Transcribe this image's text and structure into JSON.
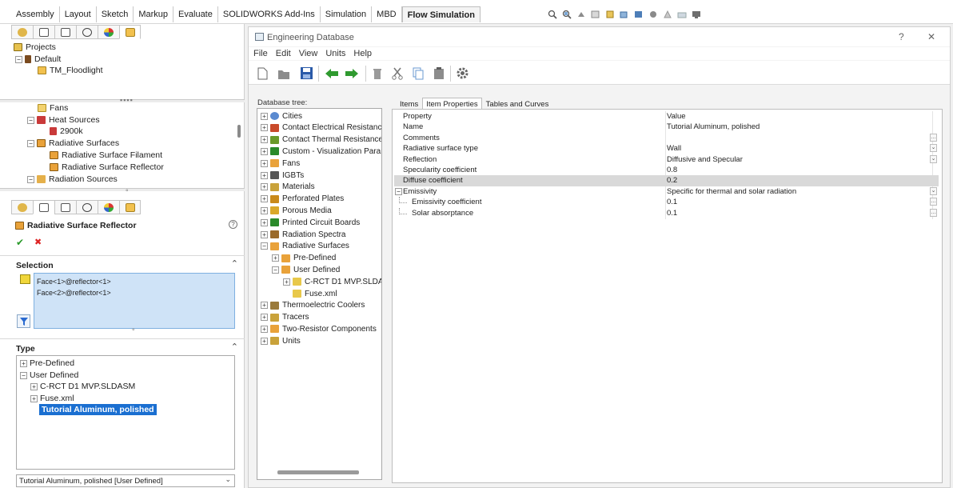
{
  "ribbon": {
    "tabs": [
      "Assembly",
      "Layout",
      "Sketch",
      "Markup",
      "Evaluate",
      "SOLIDWORKS Add-Ins",
      "Simulation",
      "MBD",
      "Flow Simulation"
    ],
    "active_tab": "Flow Simulation",
    "tool_icons": [
      "zoom-fit-icon",
      "zoom-area-icon",
      "previous-view-icon",
      "section-view-icon",
      "dynamic-annotation-icon",
      "view-orientation-icon",
      "display-style-icon",
      "hide-show-icon",
      "edit-appearance-icon",
      "apply-scene-icon",
      "view-settings-icon"
    ]
  },
  "project_tree": {
    "items": [
      {
        "label": "Projects",
        "icon": "projects-icon"
      },
      {
        "label": "Default",
        "icon": "config-icon"
      },
      {
        "label": "TM_Floodlight",
        "icon": "project-icon"
      }
    ]
  },
  "feature_tree": {
    "items": [
      {
        "label": "Fans",
        "icon": "fans-folder-icon"
      },
      {
        "label": "Heat Sources",
        "icon": "heat-sources-icon"
      },
      {
        "label": "2900k",
        "icon": "heat-source-icon"
      },
      {
        "label": "Radiative Surfaces",
        "icon": "radiative-surfaces-icon"
      },
      {
        "label": "Radiative Surface Filament",
        "icon": "radiative-surface-icon"
      },
      {
        "label": "Radiative Surface Reflector",
        "icon": "radiative-surface-icon"
      },
      {
        "label": "Radiation Sources",
        "icon": "radiation-sources-icon"
      }
    ]
  },
  "property_manager": {
    "title": "Radiative Surface Reflector",
    "help_glyph": "?",
    "ok_glyph": "✔",
    "cancel_glyph": "✖",
    "selection_header": "Selection",
    "selection_items": [
      "Face<1>@reflector<1>",
      "Face<2>@reflector<1>"
    ],
    "type_header": "Type",
    "type_tree": [
      {
        "label": "Pre-Defined",
        "level": 0,
        "toggle": "+"
      },
      {
        "label": "User Defined",
        "level": 0,
        "toggle": "−"
      },
      {
        "label": "C-RCT D1 MVP.SLDASM",
        "level": 1,
        "toggle": "+"
      },
      {
        "label": "Fuse.xml",
        "level": 1,
        "toggle": "+"
      },
      {
        "label": "Tutorial Aluminum, polished",
        "level": 2,
        "selected": true
      }
    ],
    "type_combo_value": "Tutorial Aluminum, polished [User Defined]"
  },
  "engineering_db": {
    "title": "Engineering Database",
    "help_glyph": "?",
    "close_glyph": "✕",
    "menu": [
      "File",
      "Edit",
      "View",
      "Units",
      "Help"
    ],
    "toolbar_icons": [
      "new-icon",
      "open-icon",
      "save-icon",
      "back-icon",
      "forward-icon",
      "delete-icon",
      "cut-icon",
      "copy-icon",
      "paste-icon",
      "settings-icon"
    ],
    "tree_label": "Database tree:",
    "tree": [
      {
        "label": "Cities",
        "level": 0,
        "toggle": "+"
      },
      {
        "label": "Contact Electrical Resistance",
        "level": 0,
        "toggle": "+"
      },
      {
        "label": "Contact Thermal Resistance",
        "level": 0,
        "toggle": "+"
      },
      {
        "label": "Custom - Visualization Parameters",
        "level": 0,
        "toggle": "+"
      },
      {
        "label": "Fans",
        "level": 0,
        "toggle": "+"
      },
      {
        "label": "IGBTs",
        "level": 0,
        "toggle": "+"
      },
      {
        "label": "Materials",
        "level": 0,
        "toggle": "+"
      },
      {
        "label": "Perforated Plates",
        "level": 0,
        "toggle": "+"
      },
      {
        "label": "Porous Media",
        "level": 0,
        "toggle": "+"
      },
      {
        "label": "Printed Circuit Boards",
        "level": 0,
        "toggle": "+"
      },
      {
        "label": "Radiation Spectra",
        "level": 0,
        "toggle": "+"
      },
      {
        "label": "Radiative Surfaces",
        "level": 0,
        "toggle": "−"
      },
      {
        "label": "Pre-Defined",
        "level": 1,
        "toggle": "+"
      },
      {
        "label": "User Defined",
        "level": 1,
        "toggle": "−"
      },
      {
        "label": "C-RCT D1 MVP.SLDASM",
        "level": 2,
        "toggle": "+"
      },
      {
        "label": "Fuse.xml",
        "level": 2,
        "toggle": ""
      },
      {
        "label": "Thermoelectric Coolers",
        "level": 0,
        "toggle": "+"
      },
      {
        "label": "Tracers",
        "level": 0,
        "toggle": "+"
      },
      {
        "label": "Two-Resistor Components",
        "level": 0,
        "toggle": "+"
      },
      {
        "label": "Units",
        "level": 0,
        "toggle": "+"
      }
    ],
    "item_tabs": [
      "Items",
      "Item Properties",
      "Tables and Curves"
    ],
    "active_item_tab": "Item Properties",
    "properties": [
      {
        "name": "Property",
        "value": "Value",
        "indent": 0
      },
      {
        "name": "Name",
        "value": "Tutorial Aluminum, polished",
        "indent": 0
      },
      {
        "name": "Comments",
        "value": "",
        "indent": 0,
        "button": "…"
      },
      {
        "name": "Radiative surface type",
        "value": "Wall",
        "indent": 0,
        "button": "⌄"
      },
      {
        "name": "Reflection",
        "value": "Diffusive and Specular",
        "indent": 0,
        "button": "⌄"
      },
      {
        "name": "Specularity coefficient",
        "value": "0.8",
        "indent": 0
      },
      {
        "name": "Diffuse coefficient",
        "value": "0.2",
        "indent": 0,
        "highlight": true
      },
      {
        "name": "Emissivity",
        "value": "Specific for thermal and solar radiation",
        "indent": 0,
        "toggle": "−",
        "button": "⌄"
      },
      {
        "name": "Emissivity coefficient",
        "value": "0.1",
        "indent": 1,
        "button": "…"
      },
      {
        "name": "Solar absorptance",
        "value": "0.1",
        "indent": 1,
        "button": "…"
      }
    ]
  }
}
